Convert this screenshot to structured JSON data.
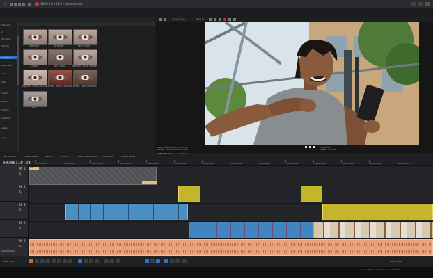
{
  "app": {
    "window_title": "VEGAS Pro 18.0 - Untitled.veg *",
    "menus": [
      "File",
      "Edit",
      "View",
      "Insert",
      "Tools",
      "Options",
      "Help"
    ]
  },
  "fx_browser": {
    "left_tree_items": [
      "Video FX",
      "All",
      "Favorites",
      "Plug-Ins",
      "Transitions",
      "Media Gen",
      "Color",
      "Eyes",
      "Presets",
      "Recent",
      "Custom",
      "Installed",
      "Legacy",
      "Sony"
    ],
    "presets": [
      {
        "label": "(Default)"
      },
      {
        "label": "Brighter"
      },
      {
        "label": "Very Bright"
      },
      {
        "label": "Subtle"
      },
      {
        "label": "Very Dark"
      },
      {
        "label": "Brighter, More Contrast"
      },
      {
        "label": "Brighter, Less Contrast"
      },
      {
        "label": "Darker, More Contrast"
      },
      {
        "label": "Darker, Less Contrast"
      },
      {
        "label": "Old"
      }
    ]
  },
  "preview": {
    "toolbar_left": "Best (Full)",
    "toolbar_zoom": "100 %",
    "project_info": "Project: 1920x1080x32, 29.970p",
    "preview_info": "Preview: 1920x1080x32, 29.970p",
    "display_info": "Display: 576x324x32",
    "frame_label": "Frame: 306",
    "display_label": "Display: 576x324",
    "video_preview_tab": "Video Preview",
    "trimmer_tab": "Trimmer"
  },
  "bottom_tabs": [
    "Live Content",
    "Project Media",
    "Explorer",
    "Video FX",
    "Media Generators",
    "Transitions",
    "Project Notes"
  ],
  "timeline": {
    "timecode": "00:00:10;28",
    "ruler_marks": [
      "00:00:00;00",
      "00:00:05;00",
      "00:00:10;00",
      "00:00:15;00",
      "00:00:20;00",
      "00:00:25;00",
      "00:00:30;00",
      "00:00:35;00",
      "00:00:40;00",
      "00:00:45;00",
      "00:00:50;00",
      "00:00:55;00",
      "00:01:00;00",
      "00:01:05;00",
      "00:01:10;00"
    ],
    "track_numbers": [
      "1",
      "2",
      "3",
      "4",
      "5"
    ],
    "track_labels": [
      "M",
      "S"
    ],
    "clip_label": "Text",
    "rate": "Rate: 0.00",
    "record_time": "Record Time (2 channels): 27:44:25"
  },
  "colors": {
    "accent": "#2f6fc4",
    "video_clip": "#4a8fc4",
    "text_clip": "#c4b52a",
    "audio_clip": "#e8a27a"
  }
}
